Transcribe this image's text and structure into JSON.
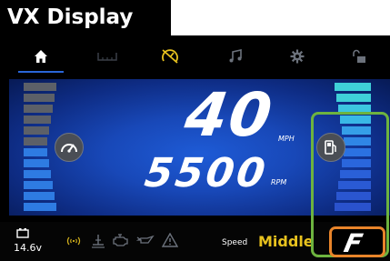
{
  "title": "VX Display",
  "nav": {
    "tabs": [
      {
        "icon": "home-icon",
        "active": true,
        "color": "#ffffff"
      },
      {
        "icon": "keyboard-icon",
        "active": false,
        "color": "#3a3f48"
      },
      {
        "icon": "speedometer-off-icon",
        "active": false,
        "color": "#e8c21e"
      },
      {
        "icon": "music-note-icon",
        "active": false,
        "color": "#6c727c"
      },
      {
        "icon": "gear-icon",
        "active": false,
        "color": "#6c727c"
      },
      {
        "icon": "unlock-icon",
        "active": false,
        "color": "#6c727c"
      }
    ]
  },
  "gauges": {
    "speed": "40",
    "speed_unit": "MPH",
    "rpm": "5500",
    "rpm_unit": "RPM",
    "left_button_icon": "tachometer-icon",
    "right_button_icon": "fuel-pump-icon"
  },
  "status": {
    "battery": "14.6v",
    "speed_label": "Speed",
    "speed_mode": "Middle",
    "mode_letter": "F",
    "icons": [
      "battery-icon",
      "wireless-signal-icon",
      "trim-icon",
      "engine-icon",
      "oil-icon",
      "warning-triangle-icon"
    ]
  },
  "colors": {
    "accent_yellow": "#e8c21e",
    "highlight_green": "#6db33f",
    "highlight_orange": "#e8842a",
    "nav_active": "#2a66d8"
  }
}
